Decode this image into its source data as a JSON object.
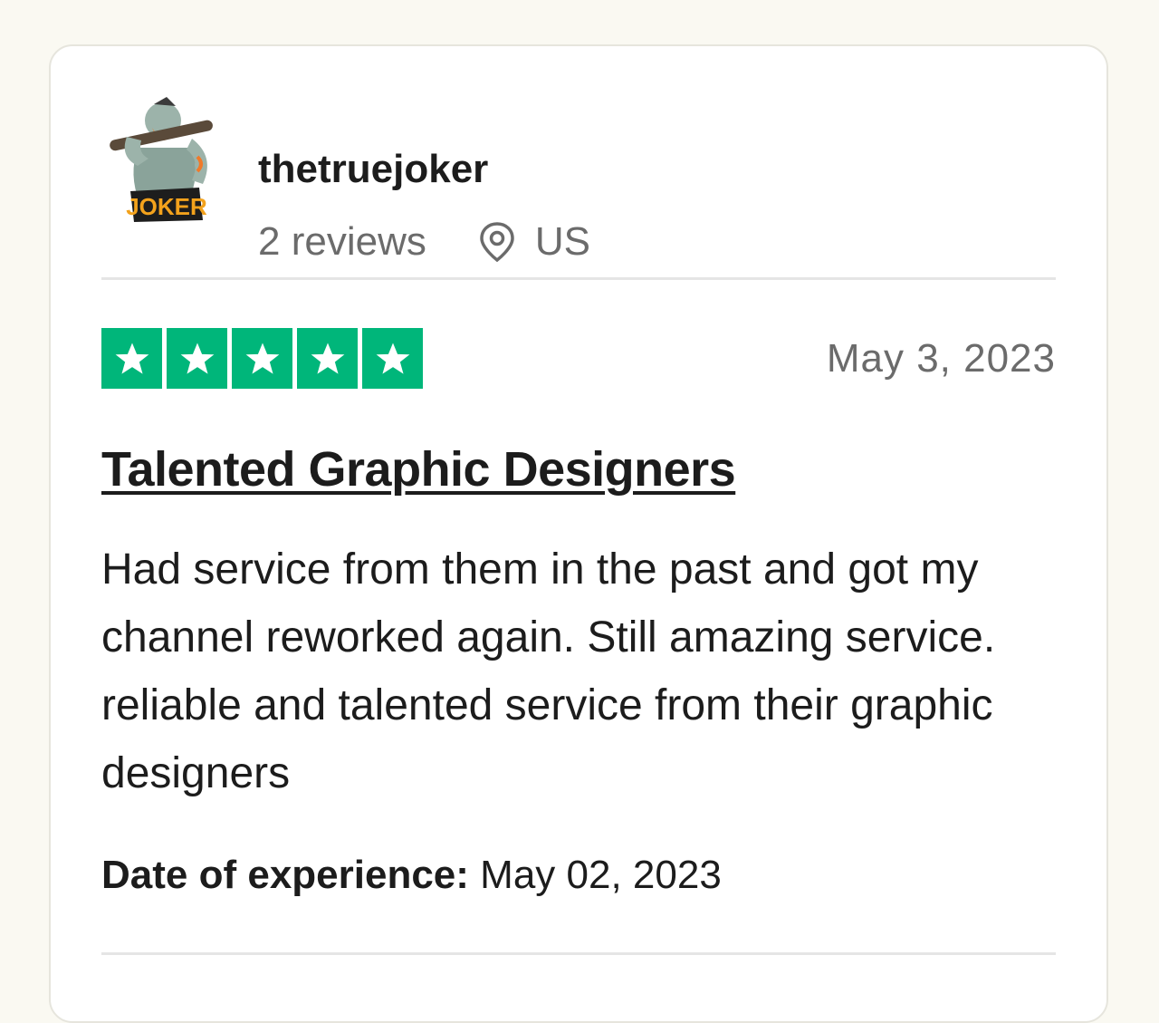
{
  "reviewer": {
    "name": "thetruejoker",
    "reviews_count": "2 reviews",
    "country": "US",
    "avatar_icon": "joker-avatar-icon",
    "avatar_logo_text": "JOKER"
  },
  "review": {
    "rating": 5,
    "rating_max": 5,
    "star_color": "#00b67a",
    "date": "May 3, 2023",
    "title": "Talented Graphic Designers",
    "body": "Had service from them in the past and got my channel reworked again. Still amazing service. reliable and talented service from their graphic designers",
    "experience_label": "Date of experience:",
    "experience_date": "May 02, 2023"
  }
}
